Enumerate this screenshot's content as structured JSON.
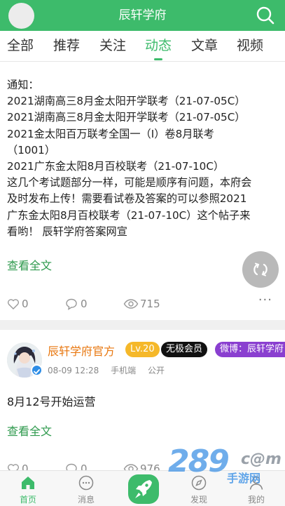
{
  "app": {
    "title": "辰轩学府"
  },
  "tabs": [
    {
      "label": "全部"
    },
    {
      "label": "推荐"
    },
    {
      "label": "关注"
    },
    {
      "label": "动态"
    },
    {
      "label": "文章"
    },
    {
      "label": "视频"
    }
  ],
  "active_tab": "动态",
  "post1": {
    "lines": [
      "通知：",
      "2021湖南高三8月金太阳开学联考（21-07-05C）",
      "2021湖南高三8月金太阳开学联考（21-07-05C）",
      "2021金太阳百万联考全国一（I）卷8月联考",
      "（1001）",
      "2021广东金太阳8月百校联考（21-07-10C）",
      "这几个考试题部分一样，可能是顺序有问题，本府会",
      "及时发布上传！需要看试卷及答案的可以参照2021",
      "广东金太阳8月百校联考（21-07-10C）这个帖子来",
      "看哟！ 辰轩学府答案网宣"
    ],
    "read_more": "查看全文",
    "likes": "0",
    "comments": "0",
    "views": "715",
    "more": "···"
  },
  "post2": {
    "username": "辰轩学府官方",
    "level": "Lv.20",
    "vip": "无极会员",
    "weibo": "微博：辰轩学府",
    "date": "08-09 12:28",
    "device": "手机端",
    "visibility": "公开",
    "text": "8月12号开始运营",
    "read_more": "查看全文",
    "likes": "0",
    "comments": "0",
    "views": "976"
  },
  "bottom_nav": [
    {
      "label": "首页",
      "icon": "home-icon"
    },
    {
      "label": "消息",
      "icon": "message-icon"
    },
    {
      "label": "",
      "icon": "rocket-icon"
    },
    {
      "label": "发现",
      "icon": "compass-icon"
    },
    {
      "label": "我的",
      "icon": "user-icon"
    }
  ],
  "watermark": {
    "brand": "289",
    "dot": "c@m",
    "sub": "手游网"
  },
  "colors": {
    "brand": "#3dbb6b",
    "link": "#2f9a4e",
    "username": "#e8770f",
    "level": "#f5b82a",
    "weibo": "#8a3fd0"
  }
}
